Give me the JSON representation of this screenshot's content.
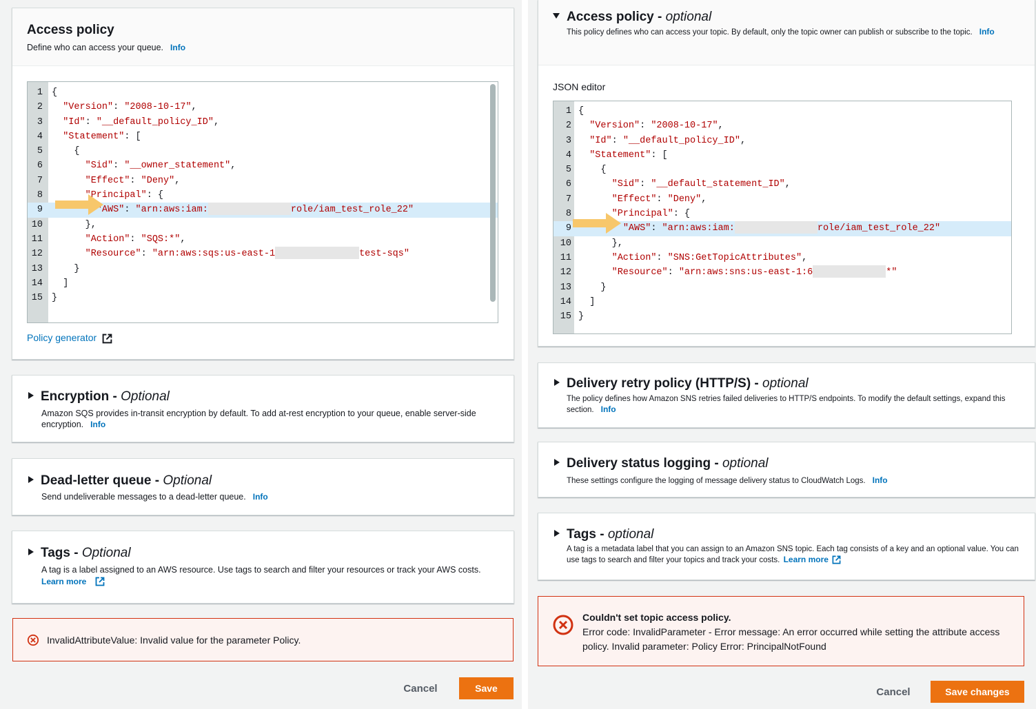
{
  "left": {
    "access_policy": {
      "title": "Access policy",
      "description": "Define who can access your queue.",
      "info": "Info",
      "code_lines": [
        {
          "num": "1",
          "indent": 0,
          "parts": [
            {
              "t": "{",
              "s": false
            }
          ]
        },
        {
          "num": "2",
          "indent": 2,
          "parts": [
            {
              "t": "\"Version\"",
              "s": true
            },
            {
              "t": ": ",
              "s": false
            },
            {
              "t": "\"2008-10-17\"",
              "s": true
            },
            {
              "t": ",",
              "s": false
            }
          ]
        },
        {
          "num": "3",
          "indent": 2,
          "parts": [
            {
              "t": "\"Id\"",
              "s": true
            },
            {
              "t": ": ",
              "s": false
            },
            {
              "t": "\"__default_policy_ID\"",
              "s": true
            },
            {
              "t": ",",
              "s": false
            }
          ]
        },
        {
          "num": "4",
          "indent": 2,
          "parts": [
            {
              "t": "\"Statement\"",
              "s": true
            },
            {
              "t": ": [",
              "s": false
            }
          ]
        },
        {
          "num": "5",
          "indent": 4,
          "parts": [
            {
              "t": "{",
              "s": false
            }
          ]
        },
        {
          "num": "6",
          "indent": 6,
          "parts": [
            {
              "t": "\"Sid\"",
              "s": true
            },
            {
              "t": ": ",
              "s": false
            },
            {
              "t": "\"__owner_statement\"",
              "s": true
            },
            {
              "t": ",",
              "s": false
            }
          ]
        },
        {
          "num": "7",
          "indent": 6,
          "parts": [
            {
              "t": "\"Effect\"",
              "s": true
            },
            {
              "t": ": ",
              "s": false
            },
            {
              "t": "\"Deny\"",
              "s": true
            },
            {
              "t": ",",
              "s": false
            }
          ]
        },
        {
          "num": "8",
          "indent": 6,
          "parts": [
            {
              "t": "\"Principal\"",
              "s": true
            },
            {
              "t": ": {",
              "s": false
            }
          ]
        },
        {
          "num": "9",
          "indent": 8,
          "hl": true,
          "parts": [
            {
              "t": "\"AWS\"",
              "s": true
            },
            {
              "t": ": ",
              "s": false
            },
            {
              "t": "\"arn:aws:iam:",
              "s": true
            },
            {
              "redact": 120
            },
            {
              "t": "role/iam_test_role_22\"",
              "s": true
            }
          ]
        },
        {
          "num": "10",
          "indent": 6,
          "parts": [
            {
              "t": "},",
              "s": false
            }
          ]
        },
        {
          "num": "11",
          "indent": 6,
          "parts": [
            {
              "t": "\"Action\"",
              "s": true
            },
            {
              "t": ": ",
              "s": false
            },
            {
              "t": "\"SQS:*\"",
              "s": true
            },
            {
              "t": ",",
              "s": false
            }
          ]
        },
        {
          "num": "12",
          "indent": 6,
          "parts": [
            {
              "t": "\"Resource\"",
              "s": true
            },
            {
              "t": ": ",
              "s": false
            },
            {
              "t": "\"arn:aws:sqs:us-east-1",
              "s": true
            },
            {
              "redact": 122
            },
            {
              "t": "test-sqs\"",
              "s": true
            }
          ]
        },
        {
          "num": "13",
          "indent": 4,
          "parts": [
            {
              "t": "}",
              "s": false
            }
          ]
        },
        {
          "num": "14",
          "indent": 2,
          "parts": [
            {
              "t": "]",
              "s": false
            }
          ]
        },
        {
          "num": "15",
          "indent": 0,
          "parts": [
            {
              "t": "}",
              "s": false
            }
          ]
        }
      ],
      "policy_generator": "Policy generator"
    },
    "encryption": {
      "title": "Encryption",
      "optional": "Optional",
      "description": "Amazon SQS provides in-transit encryption by default. To add at-rest encryption to your queue, enable server-side encryption.",
      "info": "Info"
    },
    "dead_letter": {
      "title": "Dead-letter queue",
      "optional": "Optional",
      "description": "Send undeliverable messages to a dead-letter queue.",
      "info": "Info"
    },
    "tags": {
      "title": "Tags",
      "optional": "Optional",
      "description": "A tag is a label assigned to an AWS resource. Use tags to search and filter your resources or track your AWS costs.",
      "learn_more": "Learn more"
    },
    "error": {
      "message": "InvalidAttributeValue: Invalid value for the parameter Policy."
    },
    "buttons": {
      "cancel": "Cancel",
      "save": "Save"
    }
  },
  "right": {
    "access_policy": {
      "title": "Access policy",
      "optional": "optional",
      "description": "This policy defines who can access your topic. By default, only the topic owner can publish or subscribe to the topic.",
      "info": "Info",
      "editor_label": "JSON editor",
      "code_lines": [
        {
          "num": "1",
          "indent": 0,
          "parts": [
            {
              "t": "{",
              "s": false
            }
          ]
        },
        {
          "num": "2",
          "indent": 2,
          "parts": [
            {
              "t": "\"Version\"",
              "s": true
            },
            {
              "t": ": ",
              "s": false
            },
            {
              "t": "\"2008-10-17\"",
              "s": true
            },
            {
              "t": ",",
              "s": false
            }
          ]
        },
        {
          "num": "3",
          "indent": 2,
          "parts": [
            {
              "t": "\"Id\"",
              "s": true
            },
            {
              "t": ": ",
              "s": false
            },
            {
              "t": "\"__default_policy_ID\"",
              "s": true
            },
            {
              "t": ",",
              "s": false
            }
          ]
        },
        {
          "num": "4",
          "indent": 2,
          "parts": [
            {
              "t": "\"Statement\"",
              "s": true
            },
            {
              "t": ": [",
              "s": false
            }
          ]
        },
        {
          "num": "5",
          "indent": 4,
          "parts": [
            {
              "t": "{",
              "s": false
            }
          ]
        },
        {
          "num": "6",
          "indent": 6,
          "parts": [
            {
              "t": "\"Sid\"",
              "s": true
            },
            {
              "t": ": ",
              "s": false
            },
            {
              "t": "\"__default_statement_ID\"",
              "s": true
            },
            {
              "t": ",",
              "s": false
            }
          ]
        },
        {
          "num": "7",
          "indent": 6,
          "parts": [
            {
              "t": "\"Effect\"",
              "s": true
            },
            {
              "t": ": ",
              "s": false
            },
            {
              "t": "\"Deny\"",
              "s": true
            },
            {
              "t": ",",
              "s": false
            }
          ]
        },
        {
          "num": "8",
          "indent": 6,
          "parts": [
            {
              "t": "\"Principal\"",
              "s": true
            },
            {
              "t": ": {",
              "s": false
            }
          ]
        },
        {
          "num": "9",
          "indent": 8,
          "hl": true,
          "parts": [
            {
              "t": "\"AWS\"",
              "s": true
            },
            {
              "t": ": ",
              "s": false
            },
            {
              "t": "\"arn:aws:iam:",
              "s": true
            },
            {
              "redact": 120
            },
            {
              "t": "role/iam_test_role_22\"",
              "s": true
            }
          ]
        },
        {
          "num": "10",
          "indent": 6,
          "parts": [
            {
              "t": "},",
              "s": false
            }
          ]
        },
        {
          "num": "11",
          "indent": 6,
          "parts": [
            {
              "t": "\"Action\"",
              "s": true
            },
            {
              "t": ": ",
              "s": false
            },
            {
              "t": "\"SNS:GetTopicAttributes\"",
              "s": true
            },
            {
              "t": ",",
              "s": false
            }
          ]
        },
        {
          "num": "12",
          "indent": 6,
          "parts": [
            {
              "t": "\"Resource\"",
              "s": true
            },
            {
              "t": ": ",
              "s": false
            },
            {
              "t": "\"arn:aws:sns:us-east-1:6",
              "s": true
            },
            {
              "redact": 106
            },
            {
              "t": "*\"",
              "s": true
            }
          ]
        },
        {
          "num": "13",
          "indent": 4,
          "parts": [
            {
              "t": "}",
              "s": false
            }
          ]
        },
        {
          "num": "14",
          "indent": 2,
          "parts": [
            {
              "t": "]",
              "s": false
            }
          ]
        },
        {
          "num": "15",
          "indent": 0,
          "parts": [
            {
              "t": "}",
              "s": false
            }
          ]
        }
      ]
    },
    "delivery_retry": {
      "title": "Delivery retry policy (HTTP/S)",
      "optional": "optional",
      "description": "The policy defines how Amazon SNS retries failed deliveries to HTTP/S endpoints. To modify the default settings, expand this section.",
      "info": "Info"
    },
    "delivery_logging": {
      "title": "Delivery status logging",
      "optional": "optional",
      "description": "These settings configure the logging of message delivery status to CloudWatch Logs.",
      "info": "Info"
    },
    "tags": {
      "title": "Tags",
      "optional": "optional",
      "description": "A tag is a metadata label that you can assign to an Amazon SNS topic. Each tag consists of a key and an optional value. You can use tags to search and filter your topics and track your costs.",
      "learn_more": "Learn more"
    },
    "error": {
      "title": "Couldn't set topic access policy.",
      "message": "Error code: InvalidParameter - Error message: An error occurred while setting the attribute access policy. Invalid parameter: Policy Error: PrincipalNotFound"
    },
    "buttons": {
      "cancel": "Cancel",
      "save": "Save changes"
    }
  },
  "colors": {
    "link": "#0073bb",
    "string": "#b00000",
    "primary_button": "#ec7211",
    "error_border": "#d13212",
    "highlight_line": "#d6ecfa",
    "arrow": "#f7c76b"
  }
}
